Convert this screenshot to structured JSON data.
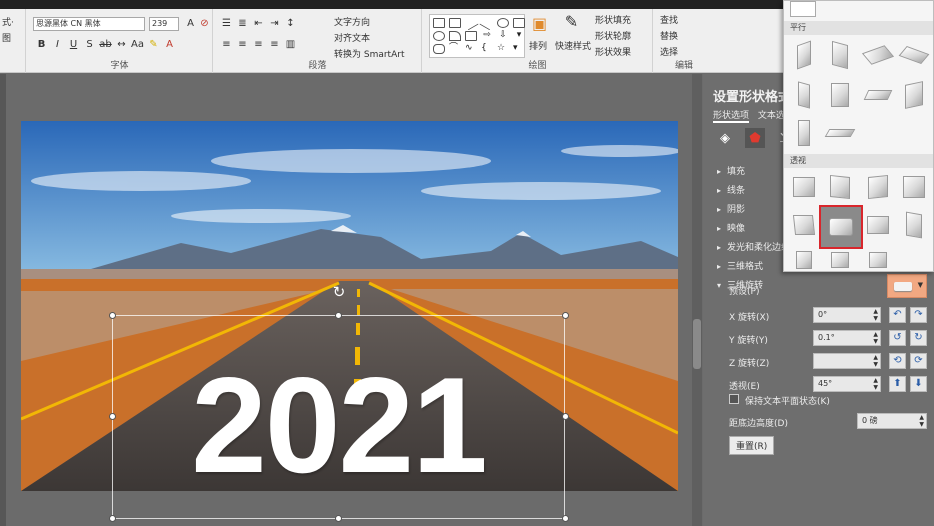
{
  "ribbon": {
    "font_group": {
      "label": "字体",
      "font_name": "思源黑体 CN 黑体",
      "font_size": "239",
      "left_truncated_1": "式·",
      "left_truncated_2": "图"
    },
    "paragraph_group": {
      "label": "段落",
      "text_direction": "文字方向",
      "align_text": "对齐文本",
      "smartart": "转换为 SmartArt"
    },
    "drawing_group": {
      "label": "绘图",
      "arrange": "排列",
      "quick_styles": "快速样式",
      "shape_fill": "形状填充",
      "shape_outline": "形状轮廓",
      "shape_effects": "形状效果"
    },
    "editing_group": {
      "label": "编辑",
      "find": "查找",
      "replace": "替换",
      "select": "选择"
    }
  },
  "slide": {
    "year_text": "2021",
    "sky_top": "#2a68b8",
    "sky_bottom": "#86b9e0",
    "desert_color": "#c9702a",
    "road_color": "#4a4543",
    "line_yellow": "#f2b705"
  },
  "pane": {
    "title": "设置形状格式",
    "tabs": [
      "形状选项",
      "文本选项"
    ],
    "sections": [
      "填充",
      "线条",
      "阴影",
      "映像",
      "发光和柔化边缘",
      "三维格式",
      "三维旋转"
    ],
    "bevel_label": "预设(P)",
    "x_rotation_label": "X 旋转(X)",
    "x_rotation_value": "0°",
    "y_rotation_label": "Y 旋转(Y)",
    "y_rotation_value": "0.1°",
    "z_rotation_label": "Z 旋转(Z)",
    "z_rotation_value": "",
    "perspective_label": "透视(E)",
    "perspective_value": "45°",
    "keep_text_flat": "保持文本平面状态(K)",
    "distance_label": "距底边高度(D)",
    "distance_value": "0 磅",
    "reset_button": "重置(R)"
  },
  "gallery": {
    "section_parallel": "平行",
    "section_perspective": "透视"
  }
}
